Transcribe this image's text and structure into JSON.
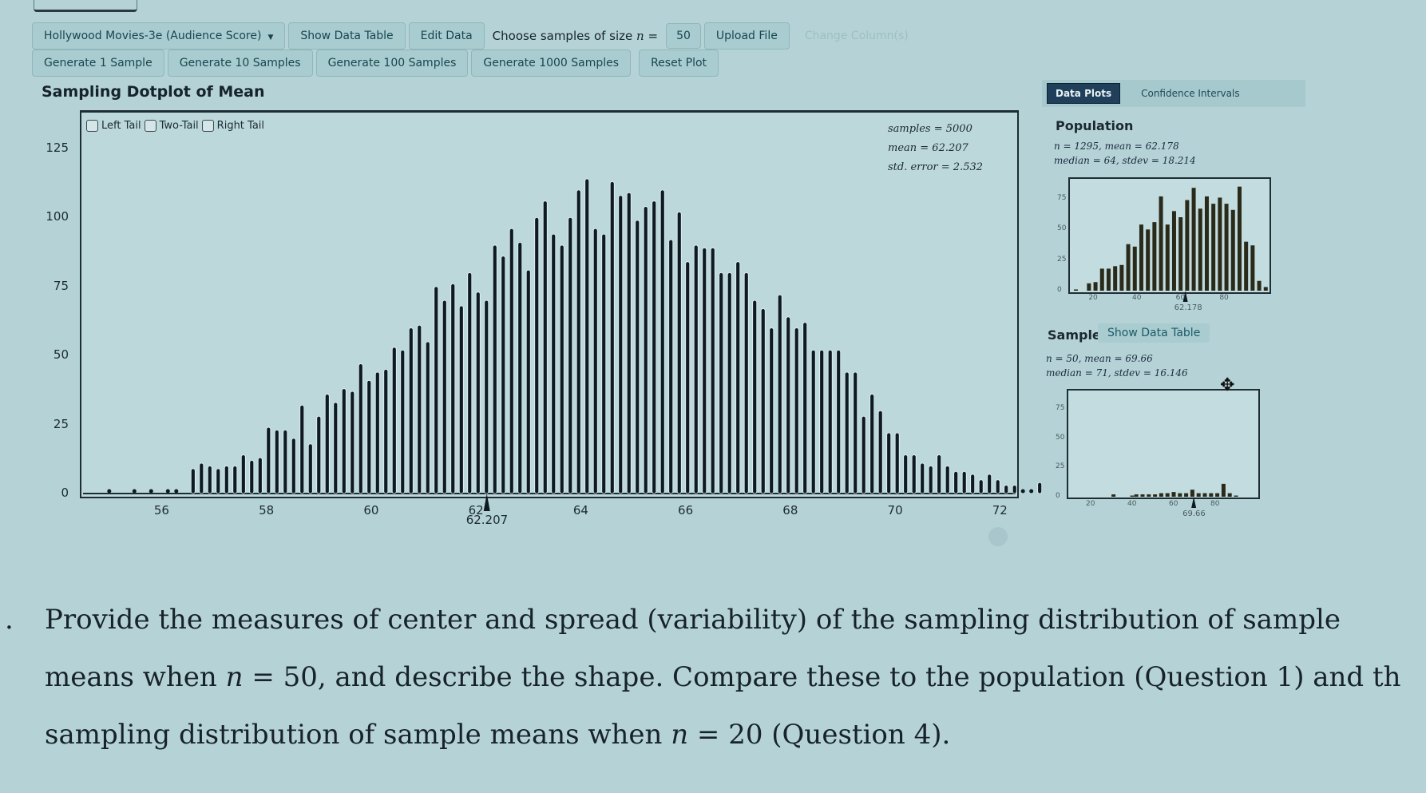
{
  "toolbar": {
    "dataset_label": "Hollywood Movies-3e (Audience Score)",
    "show_data_table": "Show Data Table",
    "edit_data": "Edit Data",
    "choose_samples_prefix": "Choose samples of size",
    "n_symbol": "n",
    "equals": "=",
    "sample_size": "50",
    "upload_file": "Upload File",
    "change_columns": "Change Column(s)"
  },
  "generate": {
    "gen1": "Generate 1 Sample",
    "gen10": "Generate 10 Samples",
    "gen100": "Generate 100 Samples",
    "gen1000": "Generate 1000 Samples",
    "reset": "Reset Plot"
  },
  "main": {
    "title": "Sampling Dotplot of Mean",
    "tails": {
      "left": "Left Tail",
      "two": "Two-Tail",
      "right": "Right Tail"
    },
    "stats": {
      "samples": "samples = 5000",
      "mean": "mean = 62.207",
      "se": "std. error = 2.532"
    },
    "mean_marker_label": "62.207"
  },
  "tabs": {
    "data_plots": "Data Plots",
    "confidence_intervals": "Confidence Intervals"
  },
  "population": {
    "title": "Population",
    "line1": "n = 1295, mean = 62.178",
    "line2": "median = 64, stdev = 18.214",
    "mean_marker_label": "62.178"
  },
  "sample": {
    "title": "Sample",
    "show_data_table": "Show Data Table",
    "line1": "n = 50, mean = 69.66",
    "line2": "median = 71, stdev = 16.146",
    "mean_marker_label": "69.66"
  },
  "question": {
    "number": ".",
    "line1": "Provide the measures of center and spread (variability) of the sampling distribution of sample",
    "line2a": "means when ",
    "line2n": "n",
    "line2b": " = 50, and describe the shape. Compare these to the population (Question 1) and th",
    "line3a": "sampling distribution of sample means when ",
    "line3n": "n",
    "line3b": " = 20 (Question 4)."
  },
  "chart_data": [
    {
      "type": "bar",
      "title": "Sampling Dotplot of Mean",
      "xlabel": "",
      "ylabel": "",
      "xlim": [
        54.5,
        72.3
      ],
      "ylim": [
        0,
        130
      ],
      "xticks": [
        56,
        58,
        60,
        62,
        64,
        66,
        68,
        70,
        72
      ],
      "yticks": [
        0,
        25,
        50,
        75,
        100,
        125
      ],
      "mean_marker": 62.207,
      "bin_start": 55.0,
      "bin_width": 0.16,
      "values": [
        1,
        0,
        0,
        1,
        0,
        2,
        0,
        2,
        2,
        0,
        9,
        11,
        10,
        9,
        10,
        10,
        14,
        12,
        13,
        24,
        23,
        23,
        20,
        32,
        18,
        28,
        36,
        33,
        38,
        37,
        47,
        41,
        44,
        45,
        53,
        52,
        60,
        61,
        55,
        75,
        70,
        76,
        68,
        80,
        73,
        70,
        90,
        86,
        96,
        91,
        81,
        100,
        106,
        94,
        90,
        100,
        110,
        114,
        96,
        94,
        113,
        108,
        109,
        99,
        104,
        106,
        110,
        92,
        102,
        84,
        90,
        89,
        89,
        80,
        80,
        84,
        80,
        70,
        67,
        60,
        72,
        64,
        60,
        62,
        52,
        52,
        52,
        52,
        44,
        44,
        28,
        36,
        30,
        22,
        22,
        14,
        14,
        11,
        10,
        14,
        10,
        8,
        8,
        7,
        5,
        7,
        5,
        3,
        3,
        2,
        2,
        4
      ]
    },
    {
      "type": "bar",
      "title": "Population",
      "xlim": [
        10,
        100
      ],
      "ylim": [
        0,
        90
      ],
      "xticks": [
        20,
        40,
        60,
        80
      ],
      "yticks": [
        0,
        25,
        50,
        75
      ],
      "mean_marker": 62.178,
      "categories": [
        12,
        15,
        18,
        21,
        24,
        27,
        30,
        33,
        36,
        39,
        42,
        45,
        48,
        51,
        54,
        57,
        60,
        63,
        66,
        69,
        72,
        75,
        78,
        81,
        84,
        87,
        90,
        93,
        96,
        99
      ],
      "values": [
        1,
        0,
        6,
        7,
        18,
        18,
        20,
        21,
        38,
        36,
        54,
        50,
        56,
        77,
        54,
        65,
        60,
        74,
        84,
        67,
        77,
        71,
        76,
        71,
        66,
        85,
        40,
        37,
        8,
        3
      ]
    },
    {
      "type": "bar",
      "title": "Sample",
      "xlim": [
        10,
        100
      ],
      "ylim": [
        0,
        90
      ],
      "xticks": [
        20,
        40,
        60,
        80
      ],
      "yticks": [
        0,
        25,
        50,
        75
      ],
      "mean_marker": 69.66,
      "categories": [
        31,
        40,
        42,
        45,
        48,
        51,
        54,
        57,
        60,
        63,
        66,
        69,
        72,
        75,
        78,
        81,
        84,
        87,
        90
      ],
      "values": [
        2,
        1,
        2,
        2,
        2,
        2,
        3,
        3,
        4,
        3,
        3,
        6,
        3,
        3,
        3,
        3,
        11,
        3,
        1
      ]
    }
  ]
}
